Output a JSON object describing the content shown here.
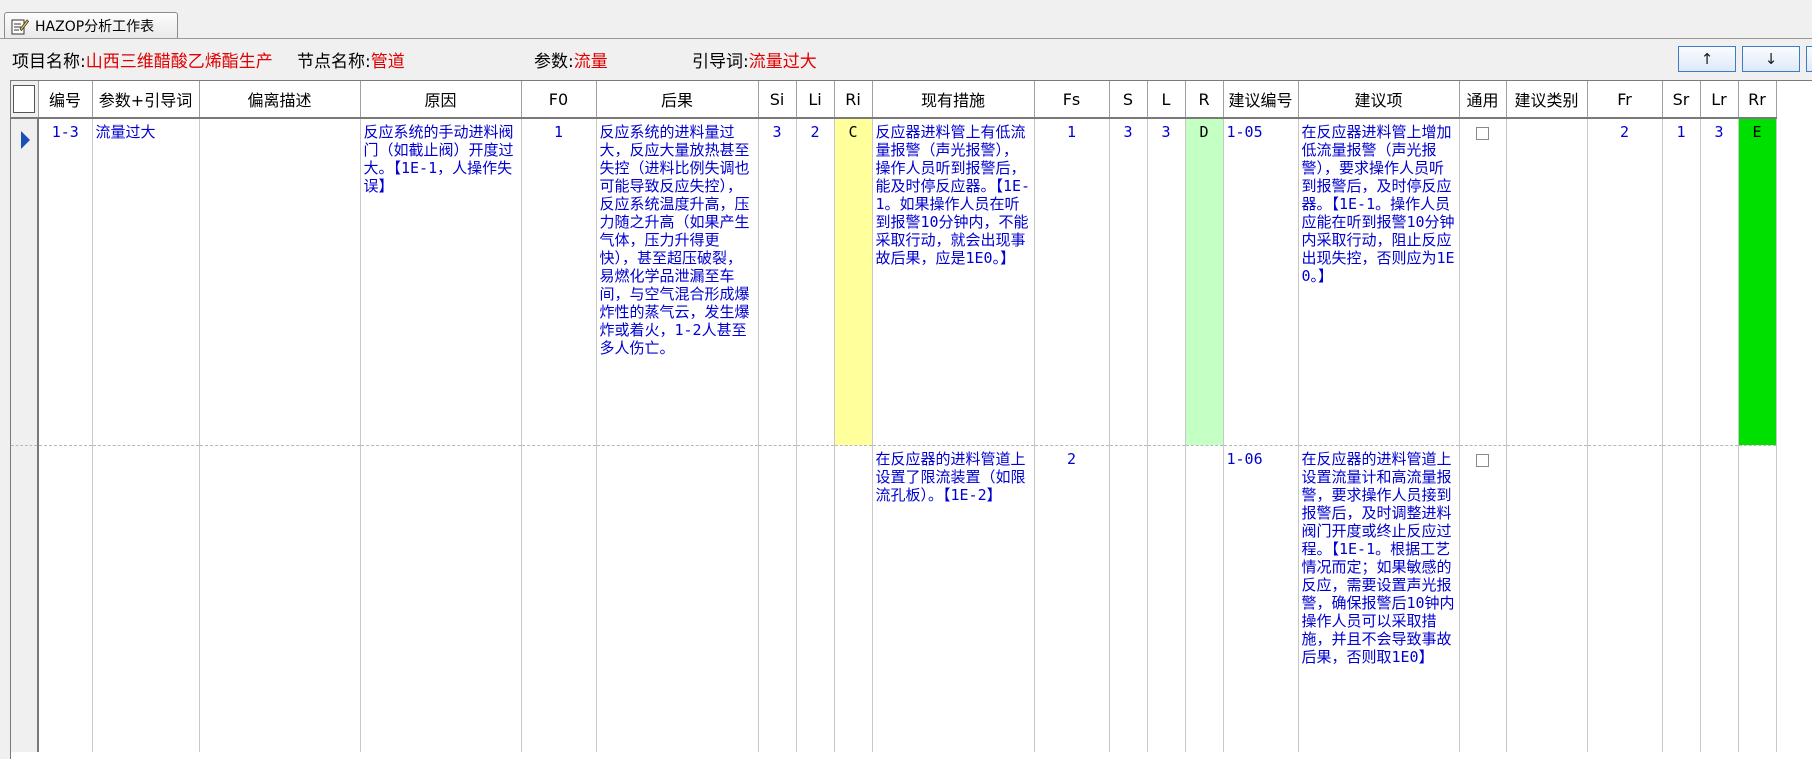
{
  "tab": {
    "title": "HAZOP分析工作表",
    "icon": "edit-doc-icon"
  },
  "info": {
    "project_label": "项目名称:",
    "project_value": "山西三维醋酸乙烯酯生产",
    "node_label": "节点名称:",
    "node_value": "管道",
    "param_label": "参数:",
    "param_value": "流量",
    "guide_label": "引导词:",
    "guide_value": "流量过大"
  },
  "nav": {
    "up": "↑",
    "down": "↓"
  },
  "columns": [
    "编号",
    "参数+引导词",
    "偏离描述",
    "原因",
    "F0",
    "后果",
    "Si",
    "Li",
    "Ri",
    "现有措施",
    "Fs",
    "S",
    "L",
    "R",
    "建议编号",
    "建议项",
    "通用",
    "建议类别",
    "Fr",
    "Sr",
    "Lr",
    "Rr"
  ],
  "rows": [
    {
      "id": "1-3",
      "param_guide": "流量过大",
      "deviation": "",
      "cause": "反应系统的手动进料阀门（如截止阀）开度过大。【1E-1，人操作失误】",
      "f0": "1",
      "consequence": "反应系统的进料量过大，反应大量放热甚至失控（进料比例失调也可能导致反应失控），反应系统温度升高，压力随之升高（如果产生气体，压力升得更快），甚至超压破裂，易燃化学品泄漏至车间，与空气混合形成爆炸性的蒸气云，发生爆炸或着火，1-2人甚至多人伤亡。",
      "si": "3",
      "li": "2",
      "ri": "C",
      "measure": "反应器进料管上有低流量报警（声光报警），操作人员听到报警后，能及时停反应器。【1E-1。如果操作人员在听到报警10分钟内，不能采取行动，就会出现事故后果，应是1E0。】",
      "fs": "1",
      "s": "3",
      "l": "3",
      "r": "D",
      "sug_no": "1-05",
      "suggestion": "在反应器进料管上增加低流量报警（声光报警），要求操作人员听到报警后，及时停反应器。【1E-1。操作人员应能在听到报警10分钟内采取行动，阻止反应出现失控，否则应为1E0。】",
      "sug_type": "",
      "fr": "2",
      "sr": "1",
      "lr": "3",
      "rr": "E"
    },
    {
      "id": "",
      "param_guide": "",
      "deviation": "",
      "cause": "",
      "f0": "",
      "consequence": "",
      "si": "",
      "li": "",
      "ri": "",
      "measure": "在反应器的进料管道上设置了限流装置（如限流孔板）。【1E-2】",
      "fs": "2",
      "s": "",
      "l": "",
      "r": "",
      "sug_no": "1-06",
      "suggestion": "在反应器的进料管道上设置流量计和高流量报警，要求操作人员接到报警后，及时调整进料阀门开度或终止反应过程。【1E-1。根据工艺情况而定；如果敏感的反应，需要设置声光报警，确保报警后10钟内操作人员可以采取措施，并且不会导致事故后果，否则取1E0】",
      "sug_type": "",
      "fr": "",
      "sr": "",
      "lr": "",
      "rr": ""
    }
  ],
  "colors": {
    "ri": "#ffff9c",
    "r": "#c4ffc4",
    "rr": "#00e000",
    "text": "#0000d0",
    "value": "#e00000"
  }
}
